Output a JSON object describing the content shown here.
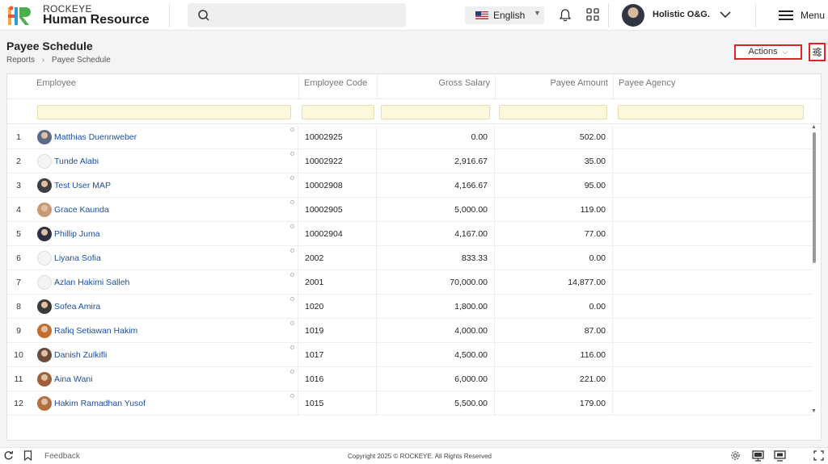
{
  "brand": {
    "line1": "ROCKEYE",
    "line2": "Human Resource"
  },
  "header": {
    "language": "English",
    "company": "Holistic O&G.",
    "menu_label": "Menu"
  },
  "page": {
    "title": "Payee Schedule",
    "breadcrumb": [
      "Reports",
      "Payee Schedule"
    ],
    "actions_label": "Actions"
  },
  "grid": {
    "columns": [
      "Employee",
      "Employee Code",
      "Gross Salary",
      "Payee Amount",
      "Payee Agency"
    ],
    "rows": [
      {
        "num": "1",
        "name": "Matthias Duennweber",
        "code": "10002925",
        "gross": "0.00",
        "payee": "502.00",
        "agency": "",
        "avatar": "photo",
        "color": "#5b6b88"
      },
      {
        "num": "2",
        "name": "Tunde Alabi",
        "code": "10002922",
        "gross": "2,916.67",
        "payee": "35.00",
        "agency": "",
        "avatar": "placeholder",
        "color": "#f0f0f0"
      },
      {
        "num": "3",
        "name": "Test User MAP",
        "code": "10002908",
        "gross": "4,166.67",
        "payee": "95.00",
        "agency": "",
        "avatar": "photo",
        "color": "#3d3f45"
      },
      {
        "num": "4",
        "name": "Grace Kaunda",
        "code": "10002905",
        "gross": "5,000.00",
        "payee": "119.00",
        "agency": "",
        "avatar": "photo",
        "color": "#c79a74"
      },
      {
        "num": "5",
        "name": "Phillip Juma",
        "code": "10002904",
        "gross": "4,167.00",
        "payee": "77.00",
        "agency": "",
        "avatar": "photo",
        "color": "#2b3140"
      },
      {
        "num": "6",
        "name": "Liyana Sofia",
        "code": "2002",
        "gross": "833.33",
        "payee": "0.00",
        "agency": "",
        "avatar": "placeholder",
        "color": "#f0f0f0"
      },
      {
        "num": "7",
        "name": "Azlan Hakimi Salleh",
        "code": "2001",
        "gross": "70,000.00",
        "payee": "14,877.00",
        "agency": "",
        "avatar": "placeholder",
        "color": "#f0f0f0"
      },
      {
        "num": "8",
        "name": "Sofea Amira",
        "code": "1020",
        "gross": "1,800.00",
        "payee": "0.00",
        "agency": "",
        "avatar": "photo",
        "color": "#3a3a3a"
      },
      {
        "num": "9",
        "name": "Rafiq Setiawan Hakim",
        "code": "1019",
        "gross": "4,000.00",
        "payee": "87.00",
        "agency": "",
        "avatar": "photo",
        "color": "#c46d2e"
      },
      {
        "num": "10",
        "name": "Danish Zulkifli",
        "code": "1017",
        "gross": "4,500.00",
        "payee": "116.00",
        "agency": "",
        "avatar": "photo",
        "color": "#6a4c3a"
      },
      {
        "num": "11",
        "name": "Aina Wani",
        "code": "1016",
        "gross": "6,000.00",
        "payee": "221.00",
        "agency": "",
        "avatar": "photo",
        "color": "#a0603a"
      },
      {
        "num": "12",
        "name": "Hakim Ramadhan Yusof",
        "code": "1015",
        "gross": "5,500.00",
        "payee": "179.00",
        "agency": "",
        "avatar": "photo",
        "color": "#b07040"
      }
    ]
  },
  "footer": {
    "feedback": "Feedback",
    "copyright": "Copyright 2025 © ROCKEYE. All Rights Reserved"
  },
  "colors": {
    "accent_red": "#e02424",
    "link_blue": "#1c4fa0",
    "filter_bg": "#fdf8dc"
  }
}
